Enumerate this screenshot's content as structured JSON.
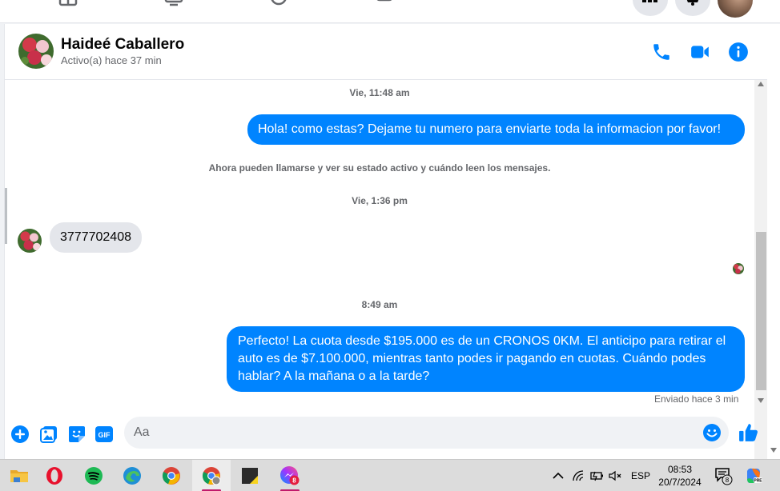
{
  "contact": {
    "name": "Haideé Caballero",
    "status": "Activo(a) hace 37 min"
  },
  "messages": {
    "time1": "Vie, 11:48 am",
    "out1": "Hola! como estas? Dejame tu numero para enviarte toda la informacion por favor!",
    "system": "Ahora pueden llamarse y ver su estado activo y cuándo leen los mensajes.",
    "time2": "Vie, 1:36 pm",
    "in1": "3777702408",
    "time3": "8:49 am",
    "out2": "Perfecto! La cuota desde $195.000 es de un CRONOS 0KM. El anticipo para retirar el auto es de $7.100.000, mientras tanto podes ir pagando en cuotas. Cuándo podes hablar? A la mañana o a la tarde?",
    "sent_status": "Enviado hace 3 min"
  },
  "composer": {
    "placeholder": "Aa",
    "gif_label": "GIF"
  },
  "taskbar": {
    "language": "ESP",
    "time": "08:53",
    "date": "20/7/2024",
    "chat_badge": "8",
    "messenger_badge": "8"
  },
  "colors": {
    "accent": "#0084ff",
    "bubble_in": "#e4e6eb",
    "text_secondary": "#65676b"
  }
}
